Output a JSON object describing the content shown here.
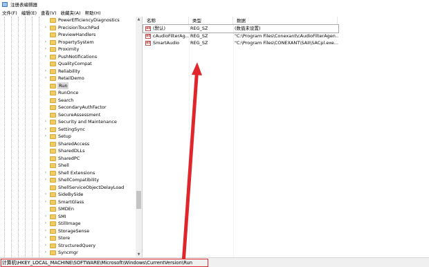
{
  "window": {
    "title": "注册表编辑器"
  },
  "menu": [
    "文件(F)",
    "编辑(E)",
    "查看(V)",
    "收藏夹(A)",
    "帮助(H)"
  ],
  "tree": {
    "items": [
      {
        "label": "PowerEfficiencyDiagnostics",
        "expandable": false
      },
      {
        "label": "PrecisionTouchPad",
        "expandable": true
      },
      {
        "label": "PreviewHandlers",
        "expandable": false
      },
      {
        "label": "PropertySystem",
        "expandable": true
      },
      {
        "label": "Proximity",
        "expandable": true
      },
      {
        "label": "PushNotifications",
        "expandable": true
      },
      {
        "label": "QualityCompat",
        "expandable": false
      },
      {
        "label": "Reliability",
        "expandable": true
      },
      {
        "label": "RetailDemo",
        "expandable": true
      },
      {
        "label": "Run",
        "expandable": false,
        "selected": true
      },
      {
        "label": "RunOnce",
        "expandable": false
      },
      {
        "label": "Search",
        "expandable": false
      },
      {
        "label": "SecondaryAuthFactor",
        "expandable": false
      },
      {
        "label": "SecureAssessment",
        "expandable": false
      },
      {
        "label": "Security and Maintenance",
        "expandable": true
      },
      {
        "label": "SettingSync",
        "expandable": true
      },
      {
        "label": "Setup",
        "expandable": true
      },
      {
        "label": "SharedAccess",
        "expandable": false
      },
      {
        "label": "SharedDLLs",
        "expandable": false
      },
      {
        "label": "SharedPC",
        "expandable": false
      },
      {
        "label": "Shell",
        "expandable": false
      },
      {
        "label": "Shell Extensions",
        "expandable": true
      },
      {
        "label": "ShellCompatibility",
        "expandable": true
      },
      {
        "label": "ShellServiceObjectDelayLoad",
        "expandable": false
      },
      {
        "label": "SideBySide",
        "expandable": true
      },
      {
        "label": "SmartGlass",
        "expandable": true
      },
      {
        "label": "SMDEn",
        "expandable": false
      },
      {
        "label": "SMI",
        "expandable": true
      },
      {
        "label": "StillImage",
        "expandable": true
      },
      {
        "label": "StorageSense",
        "expandable": true
      },
      {
        "label": "Store",
        "expandable": true
      },
      {
        "label": "StructuredQuery",
        "expandable": true
      },
      {
        "label": "Syncmgr",
        "expandable": true
      }
    ]
  },
  "list": {
    "headers": {
      "name": "名称",
      "type": "类型",
      "data": "数据"
    },
    "rows": [
      {
        "name": "(默认)",
        "type": "REG_SZ",
        "data": "(数值未设置)"
      },
      {
        "name": "cAudioFilterAg...",
        "type": "REG_SZ",
        "data": "\"C:\\Program Files\\Conexant\\cAudioFilterAgen..."
      },
      {
        "name": "SmartAudio",
        "type": "REG_SZ",
        "data": "\"C:\\Program Files\\CONEXANT\\SAII\\SACpl.exe..."
      }
    ]
  },
  "status": {
    "path": "计算机\\HKEY_LOCAL_MACHINE\\SOFTWARE\\Microsoft\\Windows\\CurrentVersion\\Run"
  },
  "colors": {
    "annotation": "#e0262b",
    "folder": "#f2cb60",
    "selection": "#d8d8d8"
  }
}
